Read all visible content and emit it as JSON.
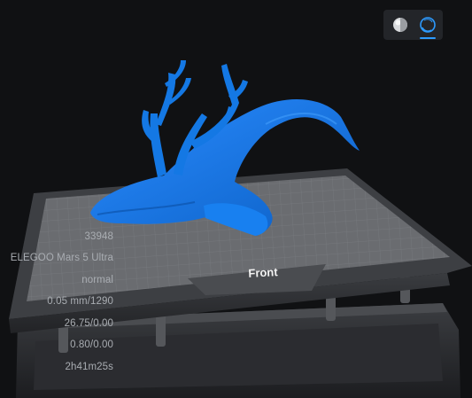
{
  "view_modes": [
    {
      "name": "solid-render-icon",
      "active": false
    },
    {
      "name": "wireframe-render-icon",
      "active": true
    }
  ],
  "info_panel": {
    "triangles": "33948",
    "printer": "ELEGOO Mars 5 Ultra",
    "quality": "normal",
    "layer": "0.05 mm/1290",
    "volume": "26.75/0.00",
    "cost": "0.80/0.00",
    "print_time": "2h41m25s"
  },
  "build_plate": {
    "front_label": "Front"
  },
  "colors": {
    "background": "#101113",
    "model": "#0f6fd6",
    "accent": "#2d9bff",
    "plate": "#5c5e62"
  }
}
